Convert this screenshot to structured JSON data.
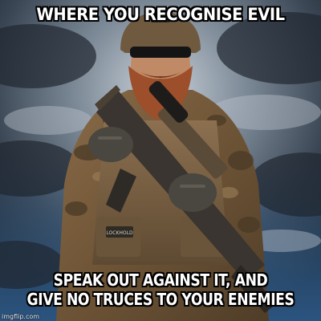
{
  "meme": {
    "top_text": "WHERE YOU RECOGNISE EVIL",
    "bottom_line_1": "SPEAK OUT AGAINST IT, AND",
    "bottom_line_2": "GIVE NO TRUCES TO YOUR ENEMIES",
    "watermark": "imgflip.com"
  },
  "scene": {
    "patch_text": "LOCKHOLD",
    "subject": "bearded-soldier-with-rifle",
    "colors": {
      "sky_dark": "#1b2430",
      "sky_light": "#9aa8b5",
      "sky_blue": "#3f6f9e",
      "camo_base": "#7a5e3f",
      "camo_dark": "#4a3a26",
      "beard": "#a0522d",
      "rifle": "#3a3530"
    }
  }
}
